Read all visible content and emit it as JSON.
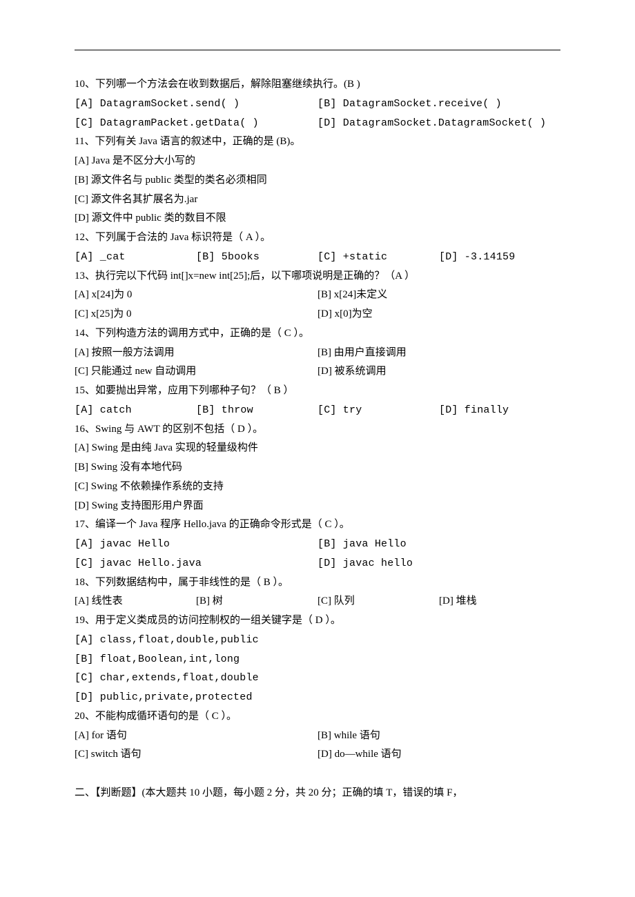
{
  "q10": {
    "stem": "10、下列哪一个方法会在收到数据后，解除阻塞继续执行。(B )",
    "a": "[A] DatagramSocket.send( )",
    "b": "[B] DatagramSocket.receive( )",
    "c": "[C] DatagramPacket.getData( )",
    "d": "[D] DatagramSocket.DatagramSocket( )"
  },
  "q11": {
    "stem": "11、下列有关 Java 语言的叙述中，正确的是 (B)。",
    "a": "[A] Java 是不区分大小写的",
    "b": "[B] 源文件名与 public 类型的类名必须相同",
    "c": "[C] 源文件名其扩展名为.jar",
    "d": "[D] 源文件中 public 类的数目不限"
  },
  "q12": {
    "stem": "12、下列属于合法的 Java 标识符是（ A ）。",
    "a": "[A] _cat",
    "b": "[B] 5books",
    "c": "[C] +static",
    "d": "[D] -3.14159"
  },
  "q13": {
    "stem": "13、执行完以下代码 int[]x=new int[25];后，以下哪项说明是正确的？（A ）",
    "a": "[A] x[24]为 0",
    "b": "[B] x[24]未定义",
    "c": "[C] x[25]为 0",
    "d": "[D] x[0]为空"
  },
  "q14": {
    "stem": "14、下列构造方法的调用方式中，正确的是（ C ）。",
    "a": "[A] 按照一般方法调用",
    "b": "[B] 由用户直接调用",
    "c": "[C] 只能通过 new 自动调用",
    "d": "[D] 被系统调用"
  },
  "q15": {
    "stem": "15、如要抛出异常，应用下列哪种子句？（ B ）",
    "a": "[A] catch",
    "b": "[B] throw",
    "c": "[C] try",
    "d": "[D] finally"
  },
  "q16": {
    "stem": "16、Swing 与 AWT 的区别不包括（ D ）。",
    "a": "[A] Swing 是由纯 Java 实现的轻量级构件",
    "b": "[B] Swing 没有本地代码",
    "c": "[C] Swing 不依赖操作系统的支持",
    "d": "[D] Swing 支持图形用户界面"
  },
  "q17": {
    "stem": "17、编译一个 Java 程序 Hello.java 的正确命令形式是（ C ）。",
    "a": "[A] javac Hello",
    "b": "[B] java Hello",
    "c": "[C] javac Hello.java",
    "d": "[D] javac hello"
  },
  "q18": {
    "stem": "18、下列数据结构中，属于非线性的是（ B ）。",
    "a": "[A] 线性表",
    "b": "[B] 树",
    "c": "[C] 队列",
    "d": "[D] 堆栈"
  },
  "q19": {
    "stem": "19、用于定义类成员的访问控制权的一组关键字是（ D ）。",
    "a": "[A] class,float,double,public",
    "b": "[B] float,Boolean,int,long",
    "c": "[C] char,extends,float,double",
    "d": "[D] public,private,protected"
  },
  "q20": {
    "stem": "20、不能构成循环语句的是（ C ）。",
    "a": "[A] for 语句",
    "b": "[B] while 语句",
    "c": "[C] switch 语句",
    "d": "[D] do—while 语句"
  },
  "section2": "二、【判断题】(本大题共 10 小题，每小题 2 分，共 20 分；正确的填 T，错误的填 F，"
}
